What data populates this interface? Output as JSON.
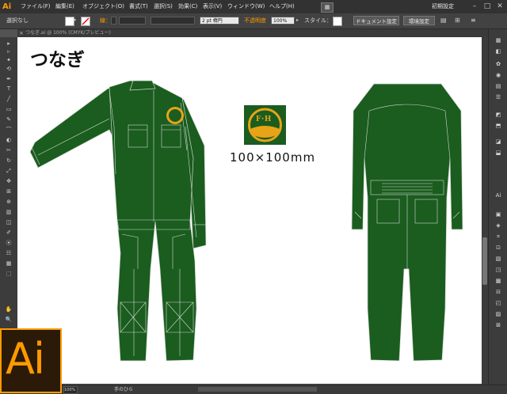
{
  "app": {
    "logo": "Ai",
    "menu": [
      "ファイル(F)",
      "編集(E)",
      "オブジェクト(O)",
      "書式(T)",
      "選択(S)",
      "効果(C)",
      "表示(V)",
      "ウィンドウ(W)",
      "ヘルプ(H)"
    ],
    "workspace": "初期設定",
    "window_buttons": [
      "–",
      "□",
      "✕"
    ]
  },
  "control": {
    "selection": "選択なし",
    "stroke_label": "線：",
    "brush": "2 pt 楕円",
    "opacity_label": "不透明度",
    "opacity_value": "100%",
    "style_label": "スタイル：",
    "doc_setup_button": "ドキュメント設定",
    "prefs_button": "環境設定"
  },
  "document": {
    "tab_label": "つなぎ.ai @ 100% (CMYK/プレビュー)",
    "close": "×"
  },
  "artboard": {
    "title": "つなぎ",
    "size_label": "100×100mm",
    "logo_text": "F･H",
    "garment_color": "#1b5c1f",
    "logo_color": "#e8a317"
  },
  "status": {
    "zoom": "100%",
    "tool_name": "手のひら"
  },
  "badge": {
    "text": "Ai",
    "color": "#ff9a00"
  },
  "tools": [
    "▸",
    "▹",
    "✦",
    "⟲",
    "✒",
    "T",
    "╱",
    "▭",
    "✎",
    "⌒",
    "◐",
    "✂",
    "↻",
    "⤢",
    "✥",
    "⊞",
    "⊕",
    "▥",
    "◫",
    "✐",
    "⦿",
    "☷",
    "▦",
    "⬚",
    "✋",
    "🔍"
  ],
  "right_panel_icons": [
    "▦",
    "◧",
    "✿",
    "◉",
    "▤",
    "☰",
    "◩",
    "⬒",
    "◪",
    "⬓",
    "Ai",
    "▣",
    "◈",
    "⌗",
    "⊡",
    "▧",
    "◳",
    "▩",
    "⊟",
    "◰",
    "▨",
    "⊠"
  ]
}
